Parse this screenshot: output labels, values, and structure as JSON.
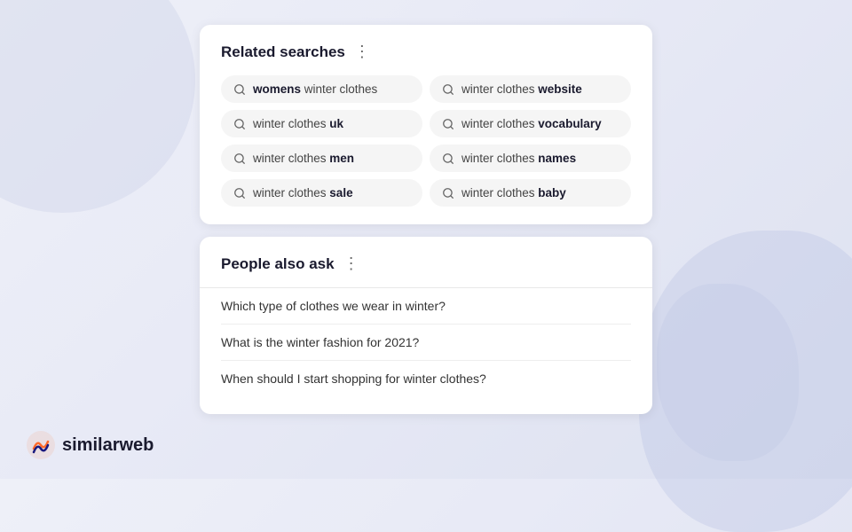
{
  "related_searches": {
    "title": "Related searches",
    "chips": [
      {
        "id": "womens",
        "text_normal": "",
        "text_bold": "womens",
        "text_after": " winter clothes",
        "display": "womens_first"
      },
      {
        "id": "website",
        "text_normal": "winter clothes ",
        "text_bold": "website",
        "text_after": ""
      },
      {
        "id": "uk",
        "text_normal": "winter clothes ",
        "text_bold": "uk",
        "text_after": ""
      },
      {
        "id": "vocabulary",
        "text_normal": "winter clothes ",
        "text_bold": "vocabulary",
        "text_after": ""
      },
      {
        "id": "men",
        "text_normal": "winter clothes ",
        "text_bold": "men",
        "text_after": ""
      },
      {
        "id": "names",
        "text_normal": "winter clothes ",
        "text_bold": "names",
        "text_after": ""
      },
      {
        "id": "sale",
        "text_normal": "winter clothes ",
        "text_bold": "sale",
        "text_after": ""
      },
      {
        "id": "baby",
        "text_normal": "winter clothes ",
        "text_bold": "baby",
        "text_after": ""
      }
    ]
  },
  "people_also_ask": {
    "title": "People also ask",
    "questions": [
      "Which type of clothes we wear in winter?",
      "What is the winter fashion for 2021?",
      "When should I start shopping for winter clothes?"
    ]
  },
  "logo": {
    "text": "similarweb"
  },
  "more_icon": "⋮"
}
